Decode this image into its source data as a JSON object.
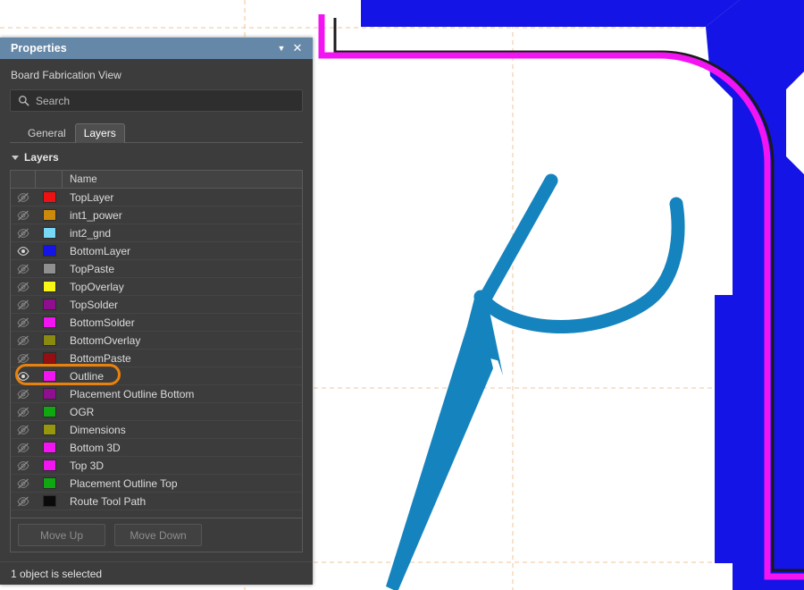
{
  "panel": {
    "title": "Properties",
    "menu_icon": "chevron-down-icon",
    "close_icon": "close-icon",
    "subtitle": "Board Fabrication View"
  },
  "search": {
    "icon": "search-icon",
    "value": "",
    "placeholder": "Search"
  },
  "tabs": [
    {
      "label": "General",
      "active": false
    },
    {
      "label": "Layers",
      "active": true
    }
  ],
  "layers_section": {
    "title": "Layers",
    "collapse_icon": "triangle-down-icon",
    "expanded": true
  },
  "layer_table": {
    "columns": [
      "",
      "",
      "Name"
    ],
    "rows": [
      {
        "name": "TopLayer",
        "color": "#ee1111",
        "visible": false
      },
      {
        "name": "int1_power",
        "color": "#cc8a0a",
        "visible": false
      },
      {
        "name": "int2_gnd",
        "color": "#77d9f5",
        "visible": false
      },
      {
        "name": "BottomLayer",
        "color": "#1414e6",
        "visible": true
      },
      {
        "name": "TopPaste",
        "color": "#8f8f8f",
        "visible": false
      },
      {
        "name": "TopOverlay",
        "color": "#f7f716",
        "visible": false
      },
      {
        "name": "TopSolder",
        "color": "#8e0e8e",
        "visible": false
      },
      {
        "name": "BottomSolder",
        "color": "#f215f2",
        "visible": false
      },
      {
        "name": "BottomOverlay",
        "color": "#8a8a10",
        "visible": false
      },
      {
        "name": "BottomPaste",
        "color": "#941010",
        "visible": false
      },
      {
        "name": "Outline",
        "color": "#f215f2",
        "visible": true
      },
      {
        "name": "Placement Outline Bottom",
        "color": "#8e108e",
        "visible": false
      },
      {
        "name": "OGR",
        "color": "#10a810",
        "visible": false
      },
      {
        "name": "Dimensions",
        "color": "#97970f",
        "visible": false
      },
      {
        "name": "Bottom 3D",
        "color": "#f215f2",
        "visible": false
      },
      {
        "name": "Top 3D",
        "color": "#f215f2",
        "visible": false
      },
      {
        "name": "Placement Outline Top",
        "color": "#10a810",
        "visible": false
      },
      {
        "name": "Route Tool Path",
        "color": "#0a0a0a",
        "visible": false
      }
    ]
  },
  "buttons": {
    "move_up": "Move Up",
    "move_down": "Move Down",
    "move_up_enabled": false,
    "move_down_enabled": false
  },
  "status": {
    "text": "1 object is selected"
  },
  "annotation": {
    "target_layer": "Outline",
    "color": "#e8820c",
    "shape": "rounded-rectangle"
  },
  "canvas": {
    "background": "#ffffff",
    "guide_color": "#f0c49a",
    "board_outline_color": "#f215f2",
    "board_edge_color": "#1a1a1a",
    "copper_color": "#1414e6",
    "pen_annotation_color": "#1583be"
  }
}
